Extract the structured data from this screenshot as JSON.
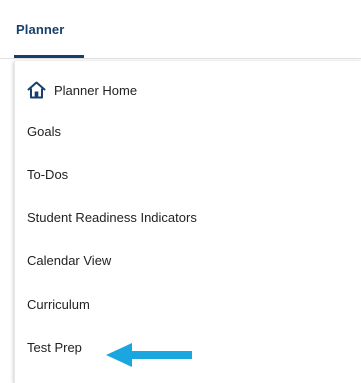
{
  "tabs": {
    "planner_label": "Planner"
  },
  "menu": {
    "items": [
      {
        "label": "Planner Home",
        "icon": "home-icon"
      },
      {
        "label": "Goals"
      },
      {
        "label": "To-Dos"
      },
      {
        "label": "Student Readiness Indicators"
      },
      {
        "label": "Calendar View"
      },
      {
        "label": "Curriculum"
      },
      {
        "label": "Test Prep"
      }
    ]
  },
  "colors": {
    "accent": "#173f6d",
    "arrow": "#1aa7e0",
    "text": "#222222"
  }
}
